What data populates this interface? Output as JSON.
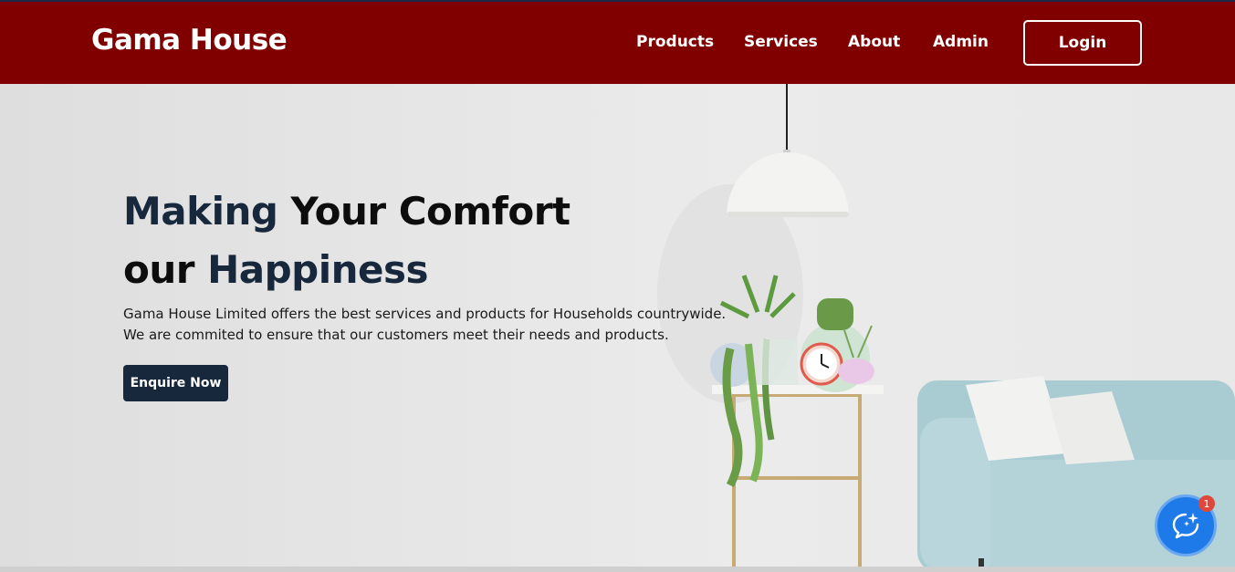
{
  "navbar": {
    "brand": "Gama House",
    "links": [
      "Products",
      "Services",
      "About",
      "Admin"
    ],
    "login_label": "Login"
  },
  "hero": {
    "headline_line1_accent": "Making",
    "headline_line1_rest": " Your Comfort",
    "headline_line2_start": "our ",
    "headline_line2_accent": "Happiness",
    "description_line1": "Gama House Limited offers the best services and products for Households countrywide.",
    "description_line2": "We are commited to ensure that our customers meet their needs and products.",
    "cta_label": "Enquire Now"
  },
  "chat_widget": {
    "icon": "chat-sparkle-icon",
    "badge_count": "1"
  },
  "colors": {
    "navbar_bg": "#800000",
    "accent_dark": "#17283c",
    "chat_blue": "#1e7ae8",
    "badge_red": "#e0473b"
  }
}
